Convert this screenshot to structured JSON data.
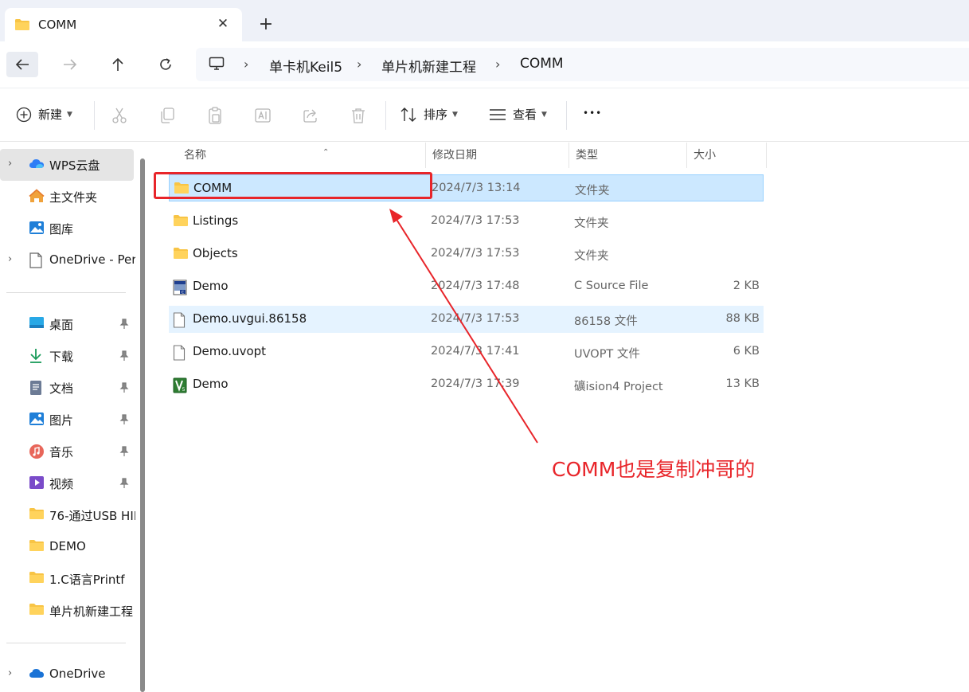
{
  "tab": {
    "title": "COMM",
    "close_glyph": "✕",
    "new_glyph": "+"
  },
  "nav": {
    "back_icon": "arrow-left-icon",
    "forward_icon": "arrow-right-icon",
    "up_icon": "arrow-up-icon",
    "refresh_icon": "refresh-icon"
  },
  "breadcrumbs": [
    "单卡机Keil5",
    "单片机新建工程",
    "COMM"
  ],
  "breadcrumb_sep": "›",
  "commandbar": {
    "new_label": "新建",
    "sort_label": "排序",
    "view_label": "查看",
    "more_glyph": "•••"
  },
  "sidebar": {
    "top_items": [
      {
        "label": "WPS云盘",
        "icon": "cloud-icon"
      },
      {
        "label": "主文件夹",
        "icon": "home-icon"
      },
      {
        "label": "图库",
        "icon": "gallery-icon"
      },
      {
        "label": "OneDrive - Per",
        "icon": "document-icon"
      }
    ],
    "pinned_items": [
      {
        "label": "桌面",
        "icon": "desktop-icon"
      },
      {
        "label": "下载",
        "icon": "download-icon"
      },
      {
        "label": "文档",
        "icon": "documents-icon"
      },
      {
        "label": "图片",
        "icon": "pictures-icon"
      },
      {
        "label": "音乐",
        "icon": "music-icon"
      },
      {
        "label": "视频",
        "icon": "video-icon"
      }
    ],
    "recent_folders": [
      "76-通过USB HII",
      "DEMO",
      "1.C语言Printf",
      "单片机新建工程"
    ],
    "bottom_items": [
      {
        "label": "OneDrive",
        "icon": "cloud-icon"
      }
    ]
  },
  "columns": {
    "name": "名称",
    "date": "修改日期",
    "type": "类型",
    "size": "大小"
  },
  "files": [
    {
      "name": "COMM",
      "date": "2024/7/3 13:14",
      "type": "文件夹",
      "size": "",
      "icon": "folder-icon"
    },
    {
      "name": "Listings",
      "date": "2024/7/3 17:53",
      "type": "文件夹",
      "size": "",
      "icon": "folder-icon"
    },
    {
      "name": "Objects",
      "date": "2024/7/3 17:53",
      "type": "文件夹",
      "size": "",
      "icon": "folder-icon"
    },
    {
      "name": "Demo",
      "date": "2024/7/3 17:48",
      "type": "C Source File",
      "size": "2 KB",
      "icon": "c-source-icon"
    },
    {
      "name": "Demo.uvgui.86158",
      "date": "2024/7/3 17:53",
      "type": "86158 文件",
      "size": "88 KB",
      "icon": "file-icon"
    },
    {
      "name": "Demo.uvopt",
      "date": "2024/7/3 17:41",
      "type": "UVOPT 文件",
      "size": "6 KB",
      "icon": "file-icon"
    },
    {
      "name": "Demo",
      "date": "2024/7/3 17:39",
      "type": "礦ision4 Project",
      "size": "13 KB",
      "icon": "keil-project-icon"
    }
  ],
  "annotation": {
    "text": "COMM也是复制冲哥的",
    "color": "#e8252a"
  },
  "colors": {
    "selection": "#cce8ff",
    "hover": "#e5f3ff",
    "accent": "#0067c0",
    "folder": "#f8c445"
  }
}
